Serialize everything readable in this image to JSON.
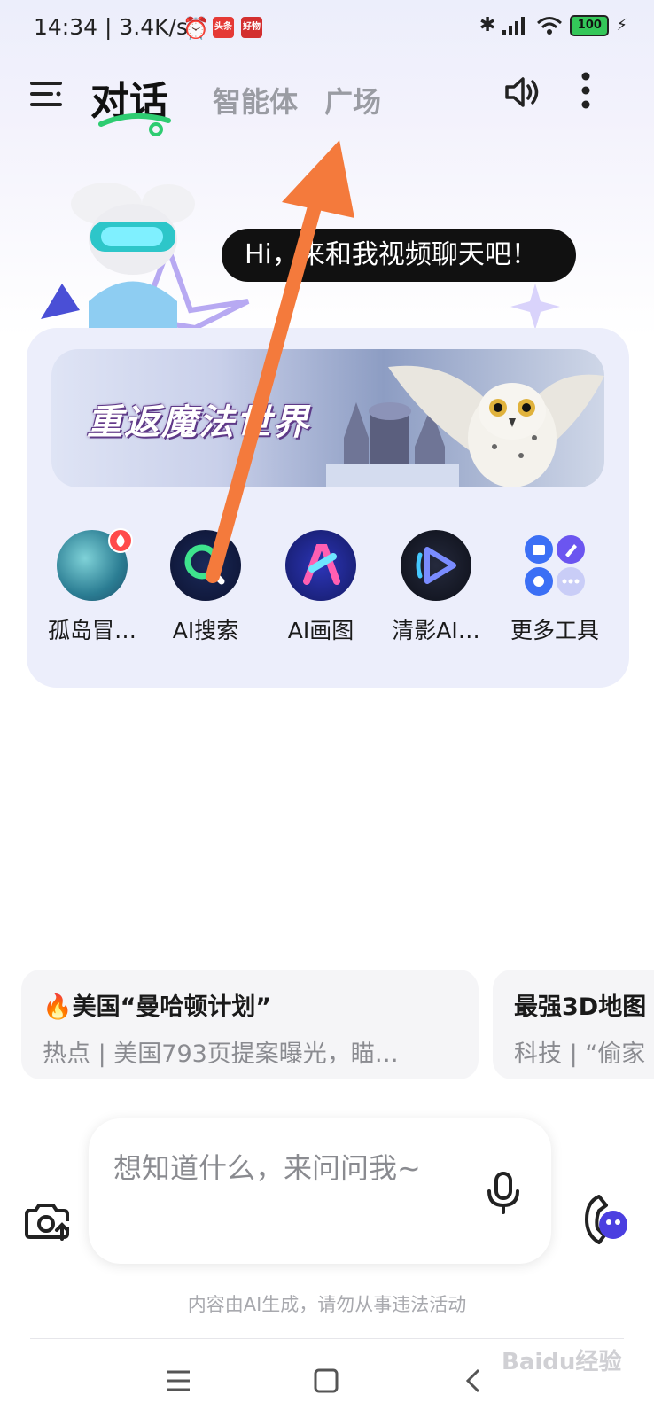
{
  "status_bar": {
    "time": "14:34 | 3.4K/s",
    "notif1": "头条",
    "notif2": "好物",
    "battery": "100"
  },
  "header": {
    "tabs": [
      "对话",
      "智能体",
      "广场"
    ],
    "active_tab": "对话"
  },
  "greeting": {
    "bubble_text": "Hi，来和我视频聊天吧！"
  },
  "banner": {
    "title": "重返魔法世界"
  },
  "tools": [
    {
      "label": "孤岛冒…",
      "icon": "island-adventure-icon"
    },
    {
      "label": "AI搜索",
      "icon": "ai-search-icon"
    },
    {
      "label": "AI画图",
      "icon": "ai-draw-icon"
    },
    {
      "label": "清影AI…",
      "icon": "qingying-video-icon"
    },
    {
      "label": "更多工具",
      "icon": "more-tools-icon"
    }
  ],
  "topics": [
    {
      "title": "🔥美国“曼哈顿计划”",
      "subtitle": "热点 | 美国793页提案曝光，瞄…"
    },
    {
      "title": "最强3D地图",
      "subtitle": "科技 | “偷家"
    }
  ],
  "input": {
    "placeholder": "想知道什么，来问问我~"
  },
  "disclaimer": "内容由AI生成，请勿从事违法活动",
  "watermark": "Baidu经验",
  "colors": {
    "accent_arrow": "#f47a3c",
    "card_bg": "#eceefb"
  }
}
